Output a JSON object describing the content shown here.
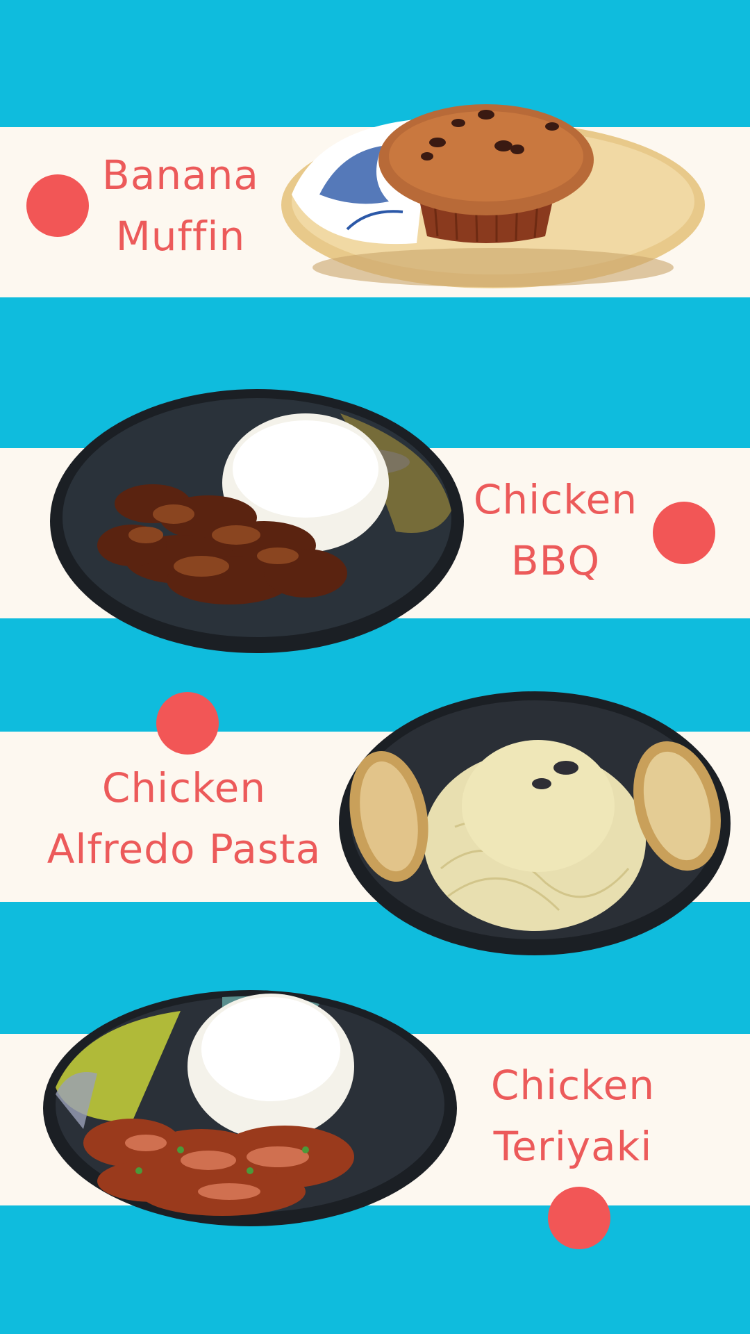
{
  "colors": {
    "background": "#0fbcdd",
    "band": "#fdf8f0",
    "accent_dot": "#f25656",
    "text": "#ec5a5a"
  },
  "menu_items": [
    {
      "line1": "Banana",
      "line2": "Muffin"
    },
    {
      "line1": "Chicken",
      "line2": "BBQ"
    },
    {
      "line1": "Chicken",
      "line2": "Alfredo Pasta"
    },
    {
      "line1": "Chicken",
      "line2": "Teriyaki"
    }
  ]
}
